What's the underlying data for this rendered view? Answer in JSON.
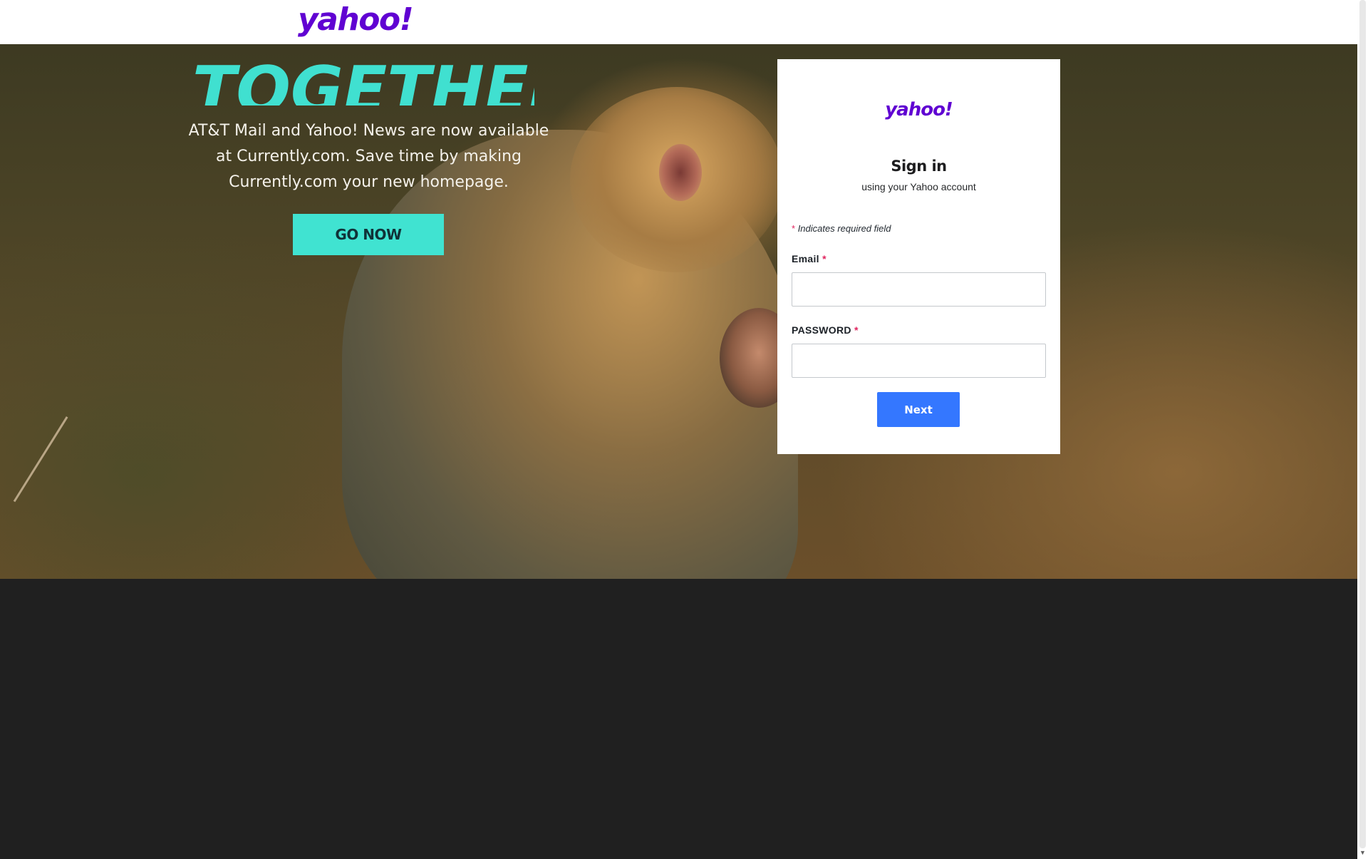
{
  "header": {
    "logo_text": "yahoo!"
  },
  "ad": {
    "headline": "TOGETHER",
    "copy_lines": [
      "AT&T Mail and Yahoo! News are now available",
      "at Currently.com. Save time by making",
      "Currently.com your new homepage."
    ],
    "cta_label": "GO NOW",
    "accent_color": "#40e3d1"
  },
  "signin": {
    "logo_text": "yahoo!",
    "title": "Sign in",
    "subtitle": "using your Yahoo account",
    "required_star": "*",
    "required_note": "Indicates required field",
    "email_label": "Email",
    "email_value": "",
    "password_label": "PASSWORD",
    "password_value": "",
    "next_label": "Next",
    "button_color": "#3477ff",
    "brand_color": "#6001d2"
  },
  "scrollbar": {
    "down_arrow_icon": "chevron-down-icon"
  }
}
